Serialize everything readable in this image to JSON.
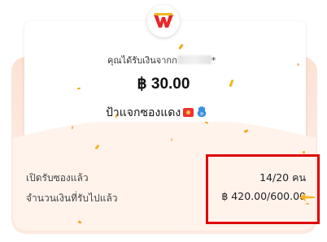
{
  "receipt": {
    "sender_prefix": "คุณได้รับเงินจากก",
    "sender_suffix": "*",
    "amount": "฿ 30.00",
    "title": "ป้าแจกซองแดง"
  },
  "stats": {
    "opened_label": "เปิดรับซองแล้ว",
    "opened_value": "14/20 คน",
    "received_label": "จำนวนเงินที่รับไปแล้ว",
    "received_value": "฿ 420.00/600.00"
  },
  "icons": {
    "logo": "wallet-logo-icon",
    "envelope": "red-envelope-icon",
    "hamsa": "hamsa-hand-icon",
    "arrow": "arrow-pointer-icon"
  },
  "colors": {
    "logo_red": "#e8262a",
    "logo_yellow": "#f5b51d",
    "panel": "#fff3ec",
    "envelope": "#fde9de",
    "highlight": "#e00000",
    "confetti": "#f5a623"
  }
}
